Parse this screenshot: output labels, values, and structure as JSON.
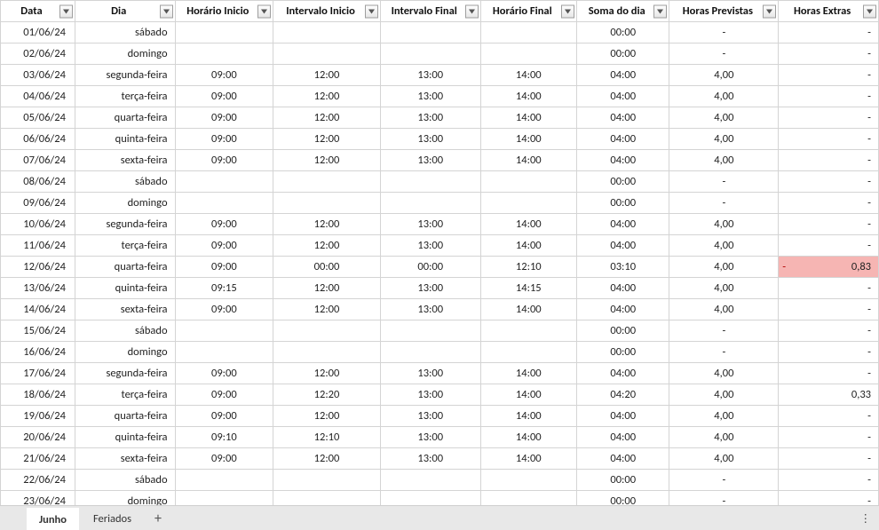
{
  "headers": {
    "data": "Data",
    "dia": "Dia",
    "horario_inicio": "Horário Inicio",
    "intervalo_inicio": "Intervalo Inicio",
    "intervalo_final": "Intervalo Final",
    "horario_final": "Horário Final",
    "soma_dia": "Soma do dia",
    "horas_previstas": "Horas Previstas",
    "horas_extras": "Horas Extras"
  },
  "rows": [
    {
      "data": "01/06/24",
      "dia": "sábado",
      "hi": "",
      "ii": "",
      "if_": "",
      "hf": "",
      "soma": "00:00",
      "prev": "-",
      "extra": "-",
      "hl": false
    },
    {
      "data": "02/06/24",
      "dia": "domingo",
      "hi": "",
      "ii": "",
      "if_": "",
      "hf": "",
      "soma": "00:00",
      "prev": "-",
      "extra": "-",
      "hl": false
    },
    {
      "data": "03/06/24",
      "dia": "segunda-feira",
      "hi": "09:00",
      "ii": "12:00",
      "if_": "13:00",
      "hf": "14:00",
      "soma": "04:00",
      "prev": "4,00",
      "extra": "-",
      "hl": false
    },
    {
      "data": "04/06/24",
      "dia": "terça-feira",
      "hi": "09:00",
      "ii": "12:00",
      "if_": "13:00",
      "hf": "14:00",
      "soma": "04:00",
      "prev": "4,00",
      "extra": "-",
      "hl": false
    },
    {
      "data": "05/06/24",
      "dia": "quarta-feira",
      "hi": "09:00",
      "ii": "12:00",
      "if_": "13:00",
      "hf": "14:00",
      "soma": "04:00",
      "prev": "4,00",
      "extra": "-",
      "hl": false
    },
    {
      "data": "06/06/24",
      "dia": "quinta-feira",
      "hi": "09:00",
      "ii": "12:00",
      "if_": "13:00",
      "hf": "14:00",
      "soma": "04:00",
      "prev": "4,00",
      "extra": "-",
      "hl": false
    },
    {
      "data": "07/06/24",
      "dia": "sexta-feira",
      "hi": "09:00",
      "ii": "12:00",
      "if_": "13:00",
      "hf": "14:00",
      "soma": "04:00",
      "prev": "4,00",
      "extra": "-",
      "hl": false
    },
    {
      "data": "08/06/24",
      "dia": "sábado",
      "hi": "",
      "ii": "",
      "if_": "",
      "hf": "",
      "soma": "00:00",
      "prev": "-",
      "extra": "-",
      "hl": false
    },
    {
      "data": "09/06/24",
      "dia": "domingo",
      "hi": "",
      "ii": "",
      "if_": "",
      "hf": "",
      "soma": "00:00",
      "prev": "-",
      "extra": "-",
      "hl": false
    },
    {
      "data": "10/06/24",
      "dia": "segunda-feira",
      "hi": "09:00",
      "ii": "12:00",
      "if_": "13:00",
      "hf": "14:00",
      "soma": "04:00",
      "prev": "4,00",
      "extra": "-",
      "hl": false
    },
    {
      "data": "11/06/24",
      "dia": "terça-feira",
      "hi": "09:00",
      "ii": "12:00",
      "if_": "13:00",
      "hf": "14:00",
      "soma": "04:00",
      "prev": "4,00",
      "extra": "-",
      "hl": false
    },
    {
      "data": "12/06/24",
      "dia": "quarta-feira",
      "hi": "09:00",
      "ii": "00:00",
      "if_": "00:00",
      "hf": "12:10",
      "soma": "03:10",
      "prev": "4,00",
      "extra": "0,83",
      "hl": true,
      "neg": true
    },
    {
      "data": "13/06/24",
      "dia": "quinta-feira",
      "hi": "09:15",
      "ii": "12:00",
      "if_": "13:00",
      "hf": "14:15",
      "soma": "04:00",
      "prev": "4,00",
      "extra": "-",
      "hl": false
    },
    {
      "data": "14/06/24",
      "dia": "sexta-feira",
      "hi": "09:00",
      "ii": "12:00",
      "if_": "13:00",
      "hf": "14:00",
      "soma": "04:00",
      "prev": "4,00",
      "extra": "-",
      "hl": false
    },
    {
      "data": "15/06/24",
      "dia": "sábado",
      "hi": "",
      "ii": "",
      "if_": "",
      "hf": "",
      "soma": "00:00",
      "prev": "-",
      "extra": "-",
      "hl": false
    },
    {
      "data": "16/06/24",
      "dia": "domingo",
      "hi": "",
      "ii": "",
      "if_": "",
      "hf": "",
      "soma": "00:00",
      "prev": "-",
      "extra": "-",
      "hl": false
    },
    {
      "data": "17/06/24",
      "dia": "segunda-feira",
      "hi": "09:00",
      "ii": "12:00",
      "if_": "13:00",
      "hf": "14:00",
      "soma": "04:00",
      "prev": "4,00",
      "extra": "-",
      "hl": false
    },
    {
      "data": "18/06/24",
      "dia": "terça-feira",
      "hi": "09:00",
      "ii": "12:20",
      "if_": "13:00",
      "hf": "14:00",
      "soma": "04:20",
      "prev": "4,00",
      "extra": "0,33",
      "hl": false
    },
    {
      "data": "19/06/24",
      "dia": "quarta-feira",
      "hi": "09:00",
      "ii": "12:00",
      "if_": "13:00",
      "hf": "14:00",
      "soma": "04:00",
      "prev": "4,00",
      "extra": "-",
      "hl": false
    },
    {
      "data": "20/06/24",
      "dia": "quinta-feira",
      "hi": "09:10",
      "ii": "12:10",
      "if_": "13:00",
      "hf": "14:00",
      "soma": "04:00",
      "prev": "4,00",
      "extra": "-",
      "hl": false
    },
    {
      "data": "21/06/24",
      "dia": "sexta-feira",
      "hi": "09:00",
      "ii": "12:00",
      "if_": "13:00",
      "hf": "14:00",
      "soma": "04:00",
      "prev": "4,00",
      "extra": "-",
      "hl": false
    },
    {
      "data": "22/06/24",
      "dia": "sábado",
      "hi": "",
      "ii": "",
      "if_": "",
      "hf": "",
      "soma": "00:00",
      "prev": "-",
      "extra": "-",
      "hl": false
    },
    {
      "data": "23/06/24",
      "dia": "domingo",
      "hi": "",
      "ii": "",
      "if_": "",
      "hf": "",
      "soma": "00:00",
      "prev": "-",
      "extra": "-",
      "hl": false
    }
  ],
  "tabs": {
    "active": "Junho",
    "other": "Feriados",
    "add": "+",
    "more": "⋮"
  }
}
